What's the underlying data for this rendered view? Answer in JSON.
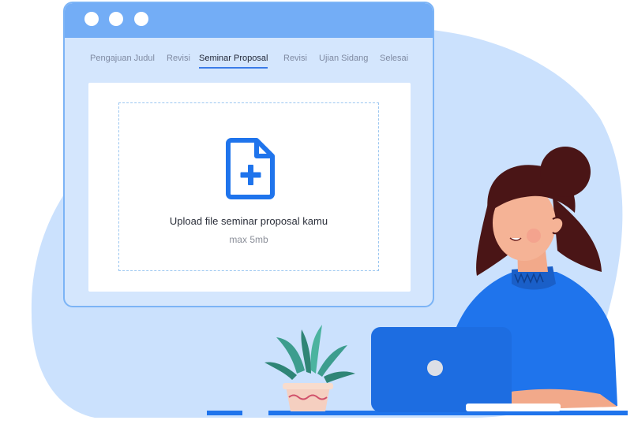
{
  "window": {
    "tabs": [
      {
        "label": "Pengajuan Judul",
        "active": false
      },
      {
        "label": "Revisi",
        "active": false
      },
      {
        "label": "Seminar Proposal",
        "active": true
      },
      {
        "label": "Revisi",
        "active": false
      },
      {
        "label": "Ujian Sidang",
        "active": false
      },
      {
        "label": "Selesai",
        "active": false
      }
    ],
    "upload": {
      "icon": "file-add-icon",
      "text": "Upload file seminar proposal kamu",
      "hint": "max 5mb"
    }
  },
  "colors": {
    "accent": "#1f74ec",
    "titlebar": "#73adf6",
    "window_bg": "#d4e6fd",
    "blob": "#c9e0fd"
  }
}
